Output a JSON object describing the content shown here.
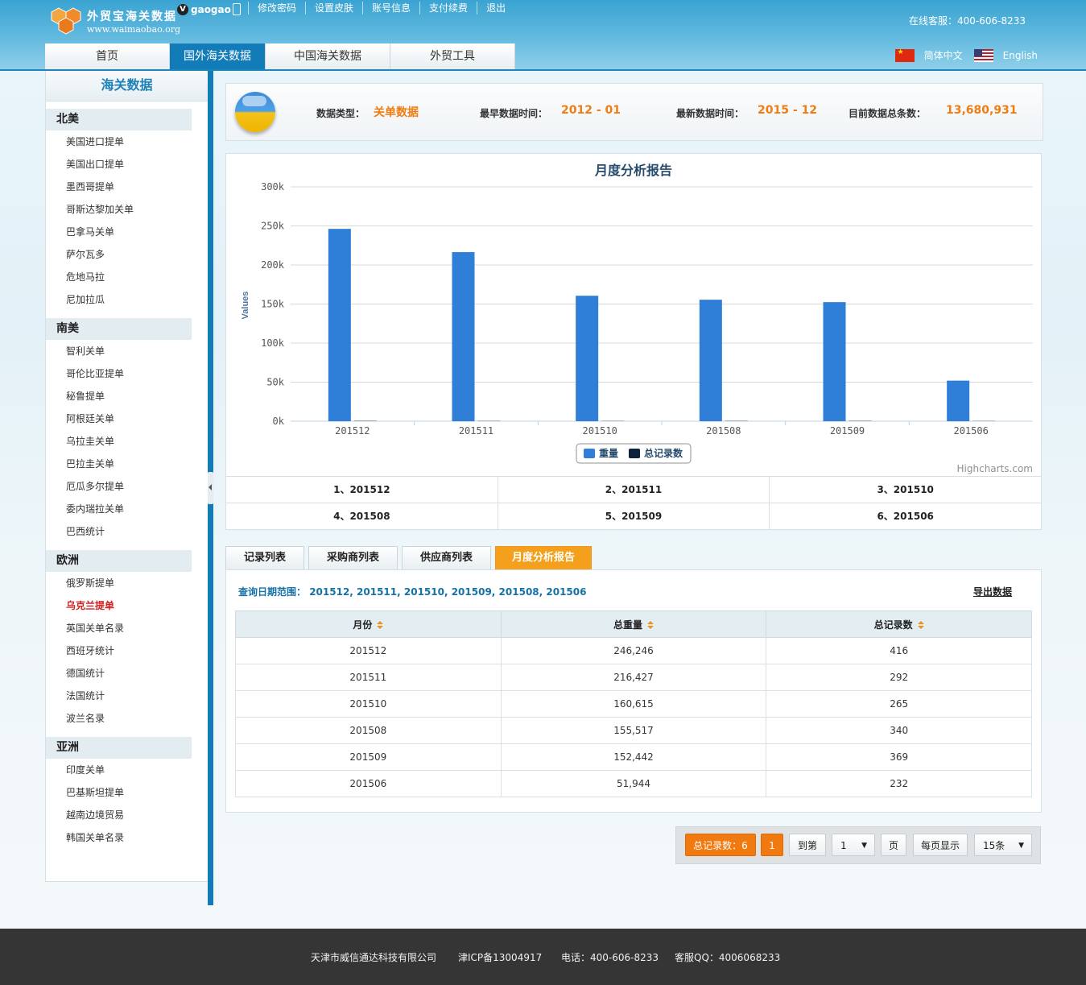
{
  "header": {
    "brand": "外贸宝海关数据",
    "url": "www.waimaobao.org",
    "badge": "V",
    "username": "gaogao",
    "top_links": [
      "修改密码",
      "设置皮肤",
      "账号信息",
      "支付续费",
      "退出"
    ],
    "service": "在线客服：400-606-8233",
    "nav": [
      "首页",
      "国外海关数据",
      "中国海关数据",
      "外贸工具"
    ],
    "nav_active": 1,
    "lang_cn": "简体中文",
    "lang_en": "English"
  },
  "sidebar": {
    "title": "海关数据",
    "regions": [
      {
        "name": "北美",
        "items": [
          "美国进口提单",
          "美国出口提单",
          "墨西哥提单",
          "哥斯达黎加关单",
          "巴拿马关单",
          "萨尔瓦多",
          "危地马拉",
          "尼加拉瓜"
        ]
      },
      {
        "name": "南美",
        "items": [
          "智利关单",
          "哥伦比亚提单",
          "秘鲁提单",
          "阿根廷关单",
          "乌拉圭关单",
          "巴拉圭关单",
          "厄瓜多尔提单",
          "委内瑞拉关单",
          "巴西统计"
        ]
      },
      {
        "name": "欧洲",
        "items": [
          "俄罗斯提单",
          "乌克兰提单",
          "英国关单名录",
          "西班牙统计",
          "德国统计",
          "法国统计",
          "波兰名录"
        ]
      },
      {
        "name": "亚洲",
        "items": [
          "印度关单",
          "巴基斯坦提单",
          "越南边境贸易",
          "韩国关单名录"
        ]
      }
    ],
    "current_item": "乌克兰提单"
  },
  "info": {
    "type_label": "数据类型：",
    "type_value": "关单数据",
    "earliest_label": "最早数据时间：",
    "earliest_value": "2012 - 01",
    "latest_label": "最新数据时间：",
    "latest_value": "2015 - 12",
    "total_label": "目前数据总条数：",
    "total_value": "13,680,931"
  },
  "chart_data": {
    "type": "bar",
    "title": "月度分析报告",
    "ylabel": "Values",
    "xlabel": "",
    "categories": [
      "201512",
      "201511",
      "201510",
      "201508",
      "201509",
      "201506"
    ],
    "series": [
      {
        "name": "重量",
        "color": "#2f7ed8",
        "values": [
          246246,
          216427,
          160615,
          155517,
          152442,
          51944
        ]
      },
      {
        "name": "总记录数",
        "color": "#0d233a",
        "values": [
          416,
          292,
          265,
          340,
          369,
          232
        ]
      }
    ],
    "ylim": [
      0,
      300000
    ],
    "yticks": [
      "0k",
      "50k",
      "100k",
      "150k",
      "200k",
      "250k",
      "300k"
    ],
    "grid": true,
    "legend": "bottom-center",
    "credits": "Highcharts.com"
  },
  "month_list": [
    "1、201512",
    "2、201511",
    "3、201510",
    "4、201508",
    "5、201509",
    "6、201506"
  ],
  "tabs": [
    "记录列表",
    "采购商列表",
    "供应商列表",
    "月度分析报告"
  ],
  "tab_active": 3,
  "table": {
    "query_label": "查询日期范围：",
    "query_value": "201512, 201511, 201510, 201509, 201508, 201506",
    "export": "导出数据",
    "columns": [
      "月份",
      "总重量",
      "总记录数"
    ],
    "rows": [
      [
        "201512",
        "246,246",
        "416"
      ],
      [
        "201511",
        "216,427",
        "292"
      ],
      [
        "201510",
        "160,615",
        "265"
      ],
      [
        "201508",
        "155,517",
        "340"
      ],
      [
        "201509",
        "152,442",
        "369"
      ],
      [
        "201506",
        "51,944",
        "232"
      ]
    ]
  },
  "pager": {
    "total": "总记录数：6",
    "current_page": "1",
    "goto": "到第",
    "page_select": "1",
    "page_unit": "页",
    "per_page_label": "每页显示",
    "per_page_select": "15条"
  },
  "footer": {
    "company": "天津市威信通达科技有限公司",
    "icp": "津ICP备13004917",
    "phone": "电话：400-606-8233",
    "qq": "客服QQ：4006068233"
  }
}
